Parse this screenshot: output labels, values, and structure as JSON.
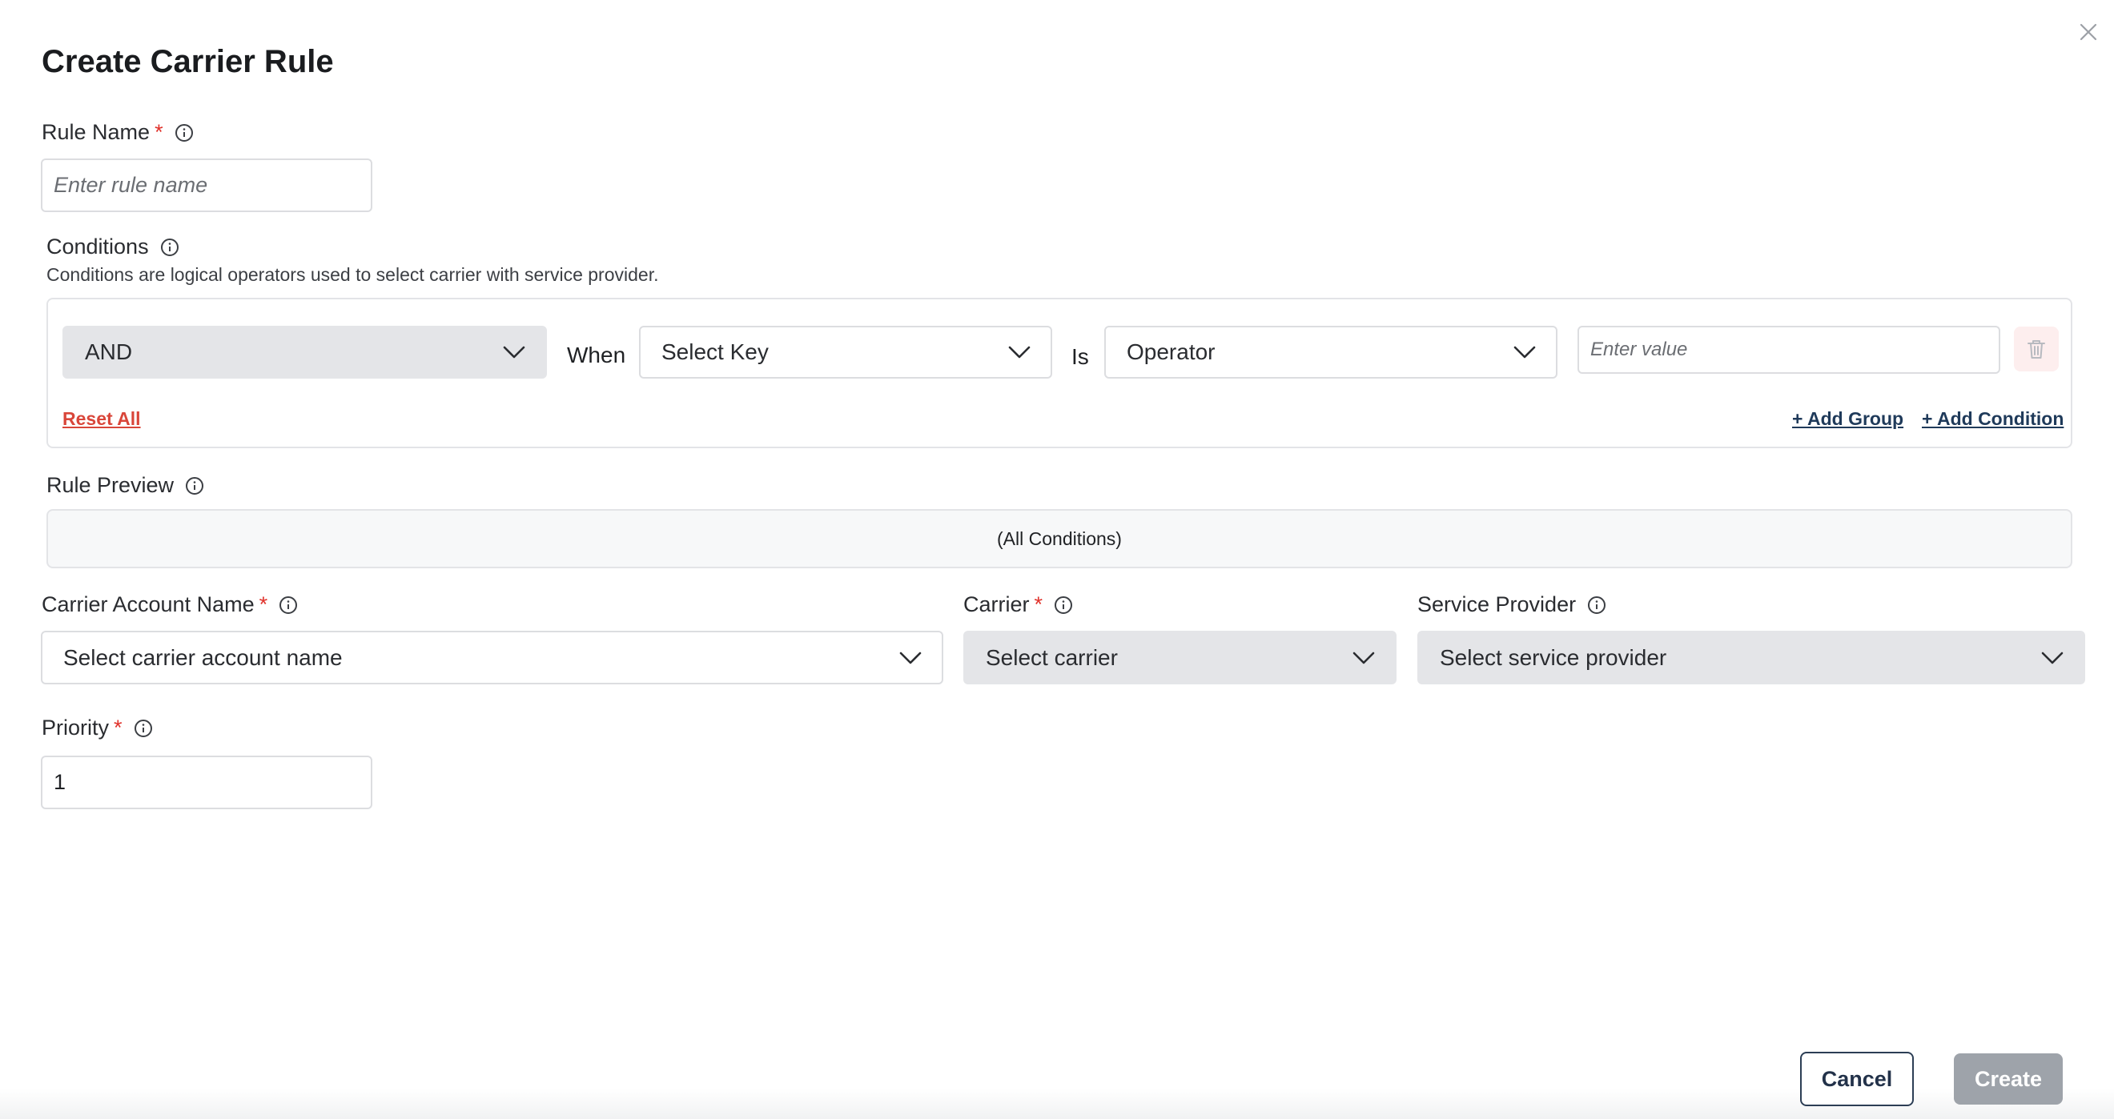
{
  "dialog": {
    "title": "Create Carrier Rule"
  },
  "rule_name": {
    "label": "Rule Name",
    "required_mark": "*",
    "placeholder": "Enter rule name",
    "value": ""
  },
  "conditions": {
    "label": "Conditions",
    "helper": "Conditions are logical operators used to select carrier with service provider.",
    "row": {
      "logic_value": "AND",
      "when_label": "When",
      "key_placeholder": "Select Key",
      "is_label": "Is",
      "operator_placeholder": "Operator",
      "value_placeholder": "Enter value"
    },
    "reset_all": "Reset All",
    "add_group": "+ Add Group",
    "add_condition": "+ Add Condition"
  },
  "rule_preview": {
    "label": "Rule Preview",
    "text": "(All Conditions)"
  },
  "carrier_account": {
    "label": "Carrier Account Name",
    "required_mark": "*",
    "placeholder": "Select carrier account name"
  },
  "carrier": {
    "label": "Carrier",
    "required_mark": "*",
    "placeholder": "Select carrier"
  },
  "service_provider": {
    "label": "Service Provider",
    "placeholder": "Select service provider"
  },
  "priority": {
    "label": "Priority",
    "required_mark": "*",
    "value": "1"
  },
  "footer": {
    "cancel_label": "Cancel",
    "create_label": "Create"
  },
  "colors": {
    "required": "#e0322b",
    "reset_link": "#d9463a",
    "add_link": "#1f3a5a",
    "create_disabled": "#9ea3aa",
    "trash_bg": "#fdeeee"
  },
  "icons": [
    "close-icon",
    "info-icon",
    "chevron-down-icon",
    "trash-icon"
  ]
}
